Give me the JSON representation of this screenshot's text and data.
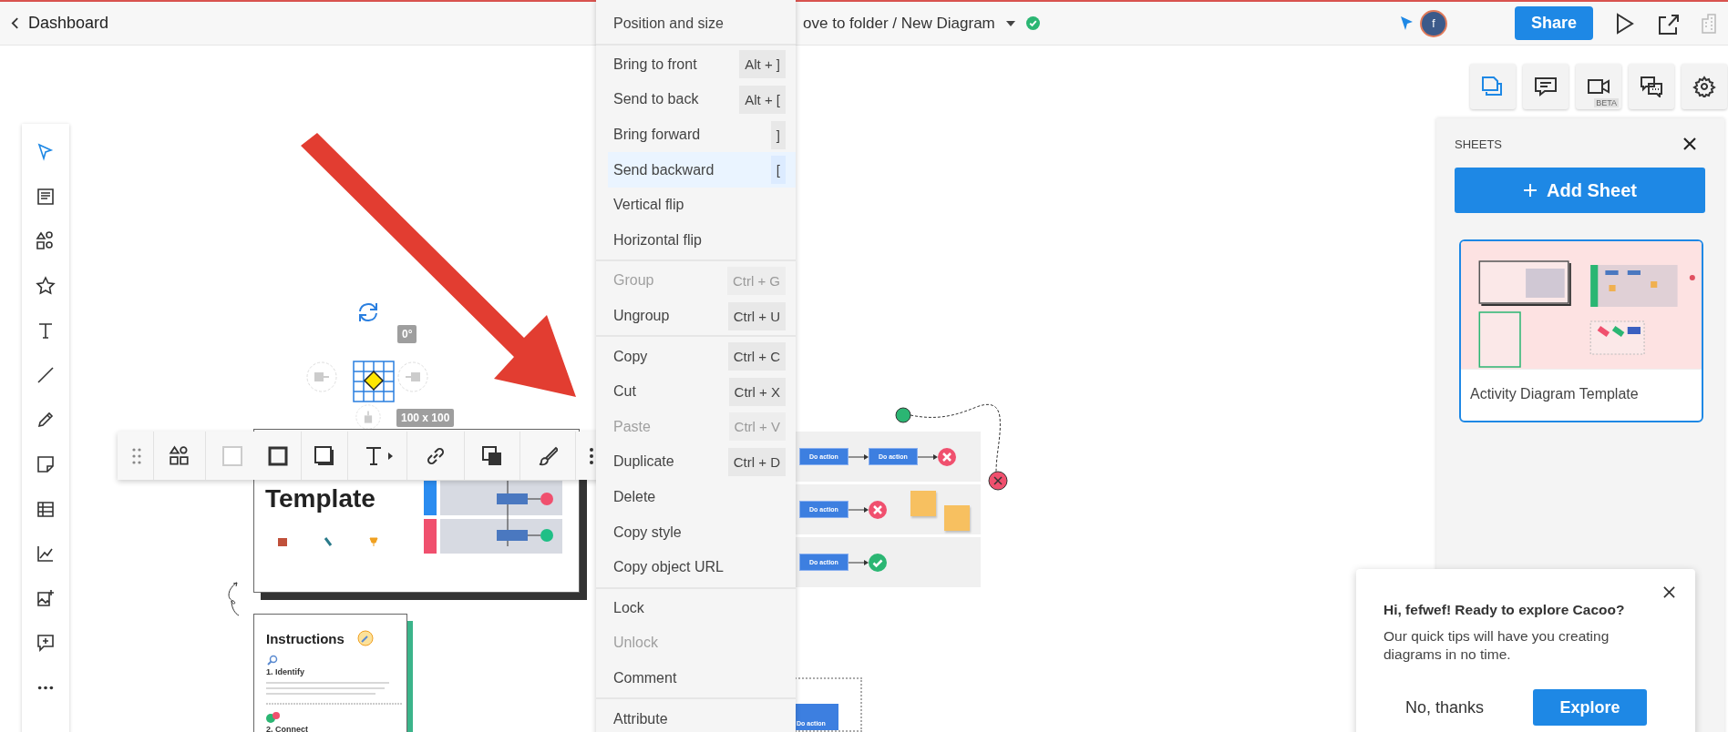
{
  "header": {
    "back_label": "Dashboard",
    "breadcrumb": "ove to folder / New Diagram",
    "saved": true,
    "share_label": "Share",
    "avatar_initial": "f"
  },
  "right_tools": [
    {
      "kind": "sheets",
      "selected": true
    },
    {
      "kind": "comment",
      "selected": false
    },
    {
      "kind": "video",
      "badge": "BETA",
      "selected": false
    },
    {
      "kind": "chat",
      "selected": false
    },
    {
      "kind": "settings",
      "selected": false
    }
  ],
  "left_tools": [
    {
      "kind": "select",
      "selected": true
    },
    {
      "kind": "page",
      "selected": false
    },
    {
      "kind": "shapes",
      "selected": false
    },
    {
      "kind": "star",
      "selected": false
    },
    {
      "kind": "text",
      "selected": false
    },
    {
      "kind": "line",
      "selected": false
    },
    {
      "kind": "pencil",
      "selected": false
    },
    {
      "kind": "sticky",
      "selected": false
    },
    {
      "kind": "table",
      "selected": false
    },
    {
      "kind": "chart",
      "selected": false
    },
    {
      "kind": "image",
      "selected": false
    },
    {
      "kind": "comment",
      "selected": false
    },
    {
      "kind": "more",
      "selected": false
    }
  ],
  "floating_toolbar": [
    {
      "kind": "drag"
    },
    {
      "kind": "shapes"
    },
    {
      "kind": "fill"
    },
    {
      "kind": "border"
    },
    {
      "kind": "shadow"
    },
    {
      "kind": "text"
    },
    {
      "kind": "link"
    },
    {
      "kind": "arrange"
    },
    {
      "kind": "style"
    },
    {
      "kind": "more"
    }
  ],
  "context_menu": [
    [
      {
        "label": "Position and size",
        "disabled": false,
        "highlighted": false
      }
    ],
    [
      {
        "label": "Bring to front",
        "shortcut": "Alt + ]",
        "disabled": false,
        "highlighted": false
      },
      {
        "label": "Send to back",
        "shortcut": "Alt + [",
        "disabled": false,
        "highlighted": false
      },
      {
        "label": "Bring forward",
        "shortcut": "]",
        "disabled": false,
        "highlighted": false
      },
      {
        "label": "Send backward",
        "shortcut": "[",
        "disabled": false,
        "highlighted": true
      },
      {
        "label": "Vertical flip",
        "disabled": false,
        "highlighted": false
      },
      {
        "label": "Horizontal flip",
        "disabled": false,
        "highlighted": false
      }
    ],
    [
      {
        "label": "Group",
        "shortcut": "Ctrl + G",
        "disabled": true,
        "highlighted": false
      },
      {
        "label": "Ungroup",
        "shortcut": "Ctrl + U",
        "disabled": false,
        "highlighted": false
      }
    ],
    [
      {
        "label": "Copy",
        "shortcut": "Ctrl + C",
        "disabled": false,
        "highlighted": false
      },
      {
        "label": "Cut",
        "shortcut": "Ctrl + X",
        "disabled": false,
        "highlighted": false
      },
      {
        "label": "Paste",
        "shortcut": "Ctrl + V",
        "disabled": true,
        "highlighted": false
      },
      {
        "label": "Duplicate",
        "shortcut": "Ctrl + D",
        "disabled": false,
        "highlighted": false
      },
      {
        "label": "Delete",
        "disabled": false,
        "highlighted": false
      },
      {
        "label": "Copy style",
        "disabled": false,
        "highlighted": false
      },
      {
        "label": "Copy object URL",
        "disabled": false,
        "highlighted": false
      }
    ],
    [
      {
        "label": "Lock",
        "disabled": false,
        "highlighted": false
      },
      {
        "label": "Unlock",
        "disabled": true,
        "highlighted": false
      },
      {
        "label": "Comment",
        "disabled": false,
        "highlighted": false
      }
    ],
    [
      {
        "label": "Attribute",
        "disabled": false,
        "highlighted": false
      }
    ]
  ],
  "canvas": {
    "rotation_label": "0°",
    "size_label": "100 x 100",
    "template_title": "Template",
    "instructions_title": "Instructions",
    "steps": [
      "1. Identify",
      "2. Connect"
    ],
    "lanes": [
      {
        "actions": [
          "Do action",
          "Do action"
        ],
        "success": false
      },
      {
        "actions": [
          "Do action"
        ],
        "success": false
      },
      {
        "actions": [
          "Do action"
        ],
        "success": true
      }
    ],
    "extra_action": "Do action"
  },
  "sheets_panel": {
    "title": "SHEETS",
    "add_label": "Add Sheet",
    "sheets": [
      {
        "name": "Activity Diagram Template",
        "selected": true
      }
    ]
  },
  "popup": {
    "title": "Hi, fefwef! Ready to explore Cacoo?",
    "body": "Our quick tips will have you creating diagrams in no time.",
    "decline_label": "No, thanks",
    "accept_label": "Explore"
  }
}
